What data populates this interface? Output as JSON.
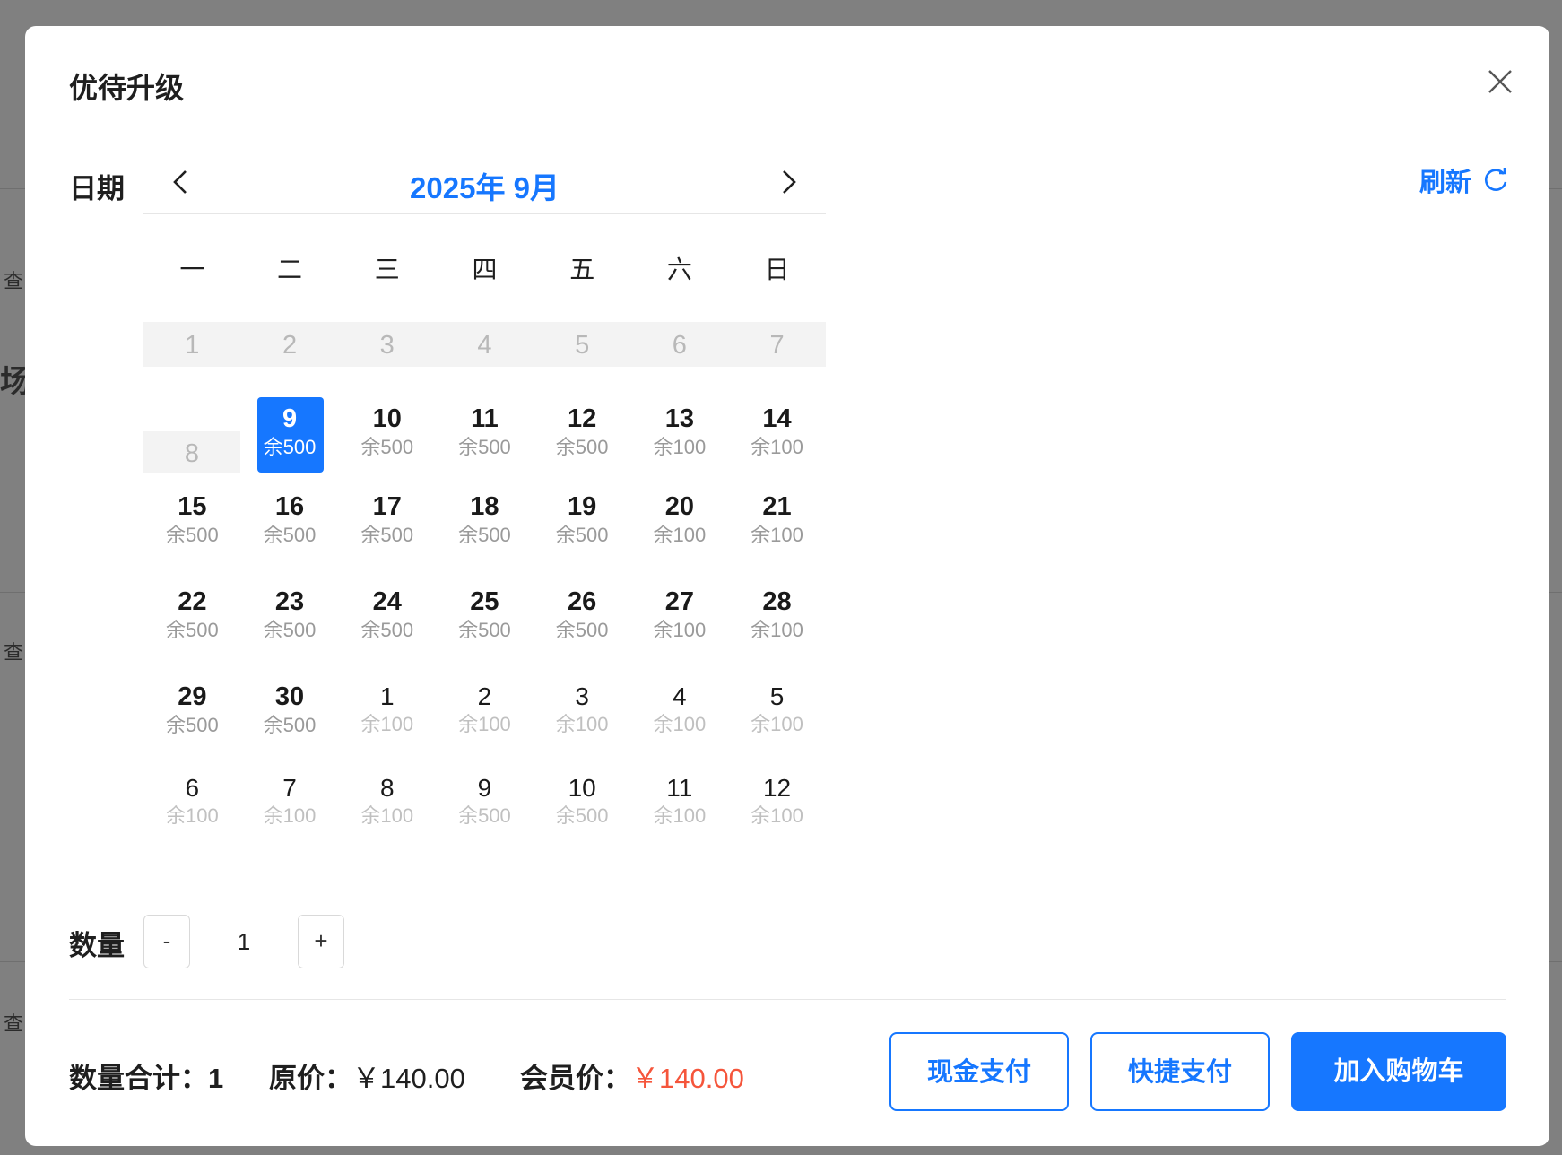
{
  "modal": {
    "title": "优待升级",
    "date_label": "日期",
    "refresh_label": "刷新",
    "quantity_label": "数量"
  },
  "calendar": {
    "month_title": "2025年 9月",
    "weekdays": [
      "一",
      "二",
      "三",
      "四",
      "五",
      "六",
      "日"
    ],
    "week1": [
      "1",
      "2",
      "3",
      "4",
      "5",
      "6",
      "7"
    ],
    "week2": [
      {
        "num": "9",
        "stock": "余500"
      },
      {
        "num": "10",
        "stock": "余500"
      },
      {
        "num": "11",
        "stock": "余500"
      },
      {
        "num": "12",
        "stock": "余500"
      },
      {
        "num": "13",
        "stock": "余100"
      },
      {
        "num": "14",
        "stock": "余100"
      }
    ],
    "day8": "8",
    "week3": [
      {
        "num": "15",
        "stock": "余500"
      },
      {
        "num": "16",
        "stock": "余500"
      },
      {
        "num": "17",
        "stock": "余500"
      },
      {
        "num": "18",
        "stock": "余500"
      },
      {
        "num": "19",
        "stock": "余500"
      },
      {
        "num": "20",
        "stock": "余100"
      },
      {
        "num": "21",
        "stock": "余100"
      }
    ],
    "week4": [
      {
        "num": "22",
        "stock": "余500"
      },
      {
        "num": "23",
        "stock": "余500"
      },
      {
        "num": "24",
        "stock": "余500"
      },
      {
        "num": "25",
        "stock": "余500"
      },
      {
        "num": "26",
        "stock": "余500"
      },
      {
        "num": "27",
        "stock": "余100"
      },
      {
        "num": "28",
        "stock": "余100"
      }
    ],
    "week5": [
      {
        "num": "29",
        "stock": "余500"
      },
      {
        "num": "30",
        "stock": "余500"
      },
      {
        "num": "1",
        "stock": "余100"
      },
      {
        "num": "2",
        "stock": "余100"
      },
      {
        "num": "3",
        "stock": "余100"
      },
      {
        "num": "4",
        "stock": "余100"
      },
      {
        "num": "5",
        "stock": "余100"
      }
    ],
    "week6": [
      {
        "num": "6",
        "stock": "余100"
      },
      {
        "num": "7",
        "stock": "余100"
      },
      {
        "num": "8",
        "stock": "余100"
      },
      {
        "num": "9",
        "stock": "余500"
      },
      {
        "num": "10",
        "stock": "余500"
      },
      {
        "num": "11",
        "stock": "余100"
      },
      {
        "num": "12",
        "stock": "余100"
      }
    ]
  },
  "quantity": {
    "minus": "-",
    "value": "1",
    "plus": "+"
  },
  "summary": {
    "total_qty_label": "数量合计：",
    "total_qty": "1",
    "original_label": "原价：",
    "original_price": "￥140.00",
    "member_label": "会员价：",
    "member_price": "￥140.00"
  },
  "actions": {
    "cash": "现金支付",
    "quick": "快捷支付",
    "cart": "加入购物车"
  },
  "background": {
    "chars": [
      "查",
      "场",
      "查",
      "查"
    ]
  },
  "colors": {
    "accent": "#1677ff",
    "price": "#f5553b"
  }
}
